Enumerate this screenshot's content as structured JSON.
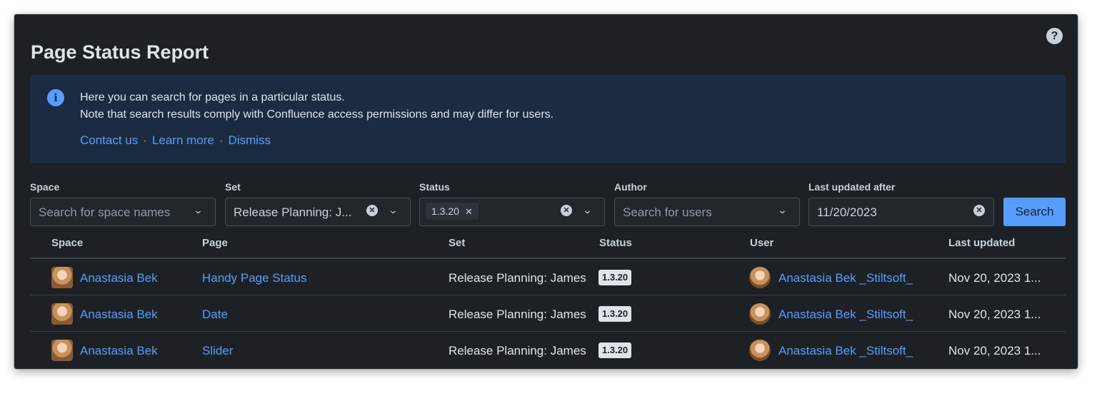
{
  "title": "Page Status Report",
  "help_icon": "question-circle-icon",
  "banner": {
    "icon": "info-icon",
    "line1": "Here you can search for pages in a particular status.",
    "line2": "Note that search results comply with Confluence access permissions and may differ for users.",
    "links": [
      "Contact us",
      "Learn more",
      "Dismiss"
    ],
    "separator": "·"
  },
  "filters": {
    "space": {
      "label": "Space",
      "placeholder": "Search for space names"
    },
    "set": {
      "label": "Set",
      "value": "Release Planning: J..."
    },
    "status": {
      "label": "Status",
      "chip": "1.3.20"
    },
    "author": {
      "label": "Author",
      "placeholder": "Search for users"
    },
    "last_updated": {
      "label": "Last updated after",
      "value": "11/20/2023"
    },
    "search_label": "Search"
  },
  "table": {
    "headers": [
      "Space",
      "Page",
      "Set",
      "Status",
      "User",
      "Last updated"
    ],
    "rows": [
      {
        "space": "Anastasia Bek",
        "page": "Handy Page Status",
        "set": "Release Planning: James",
        "status": "1.3.20",
        "user": "Anastasia Bek _Stiltsoft_",
        "updated": "Nov 20, 2023 1..."
      },
      {
        "space": "Anastasia Bek",
        "page": "Date",
        "set": "Release Planning: James",
        "status": "1.3.20",
        "user": "Anastasia Bek _Stiltsoft_",
        "updated": "Nov 20, 2023 1..."
      },
      {
        "space": "Anastasia Bek",
        "page": "Slider",
        "set": "Release Planning: James",
        "status": "1.3.20",
        "user": "Anastasia Bek _Stiltsoft_",
        "updated": "Nov 20, 2023 1..."
      }
    ]
  },
  "colors": {
    "background": "#1d2125",
    "link": "#579dff",
    "banner": "#1c2b41",
    "button": "#579dff"
  }
}
